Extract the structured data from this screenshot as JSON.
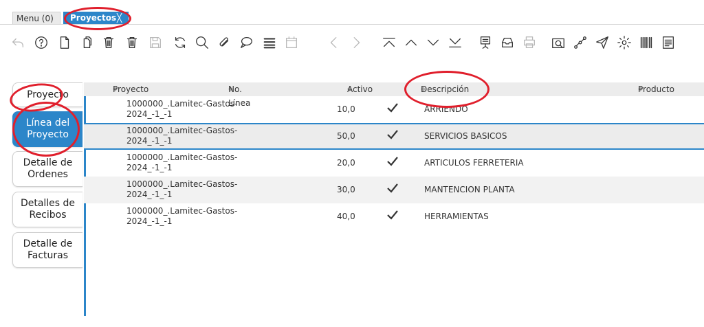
{
  "tabs": {
    "menu_label": "Menu (0)",
    "active_label": "Proyectos",
    "close_glyph": "╳"
  },
  "toolbar": {
    "icons": [
      "undo-icon",
      "help-icon",
      "new-record-icon",
      "copy-icon",
      "delete-icon",
      "delete-selection-icon",
      "save-icon",
      "refresh-icon",
      "find-icon",
      "attachment-icon",
      "chat-icon",
      "grid-toggle-icon",
      "calendar-icon",
      "previous-icon",
      "next-icon",
      "first-record-icon",
      "parent-icon",
      "detail-icon",
      "last-record-icon",
      "report-icon",
      "archive-icon",
      "print-icon",
      "zoom-across-icon",
      "workflow-icon",
      "send-icon",
      "settings-icon",
      "barcode-icon",
      "summary-icon"
    ]
  },
  "sidebar": {
    "items": [
      {
        "label": "Proyecto",
        "active": false
      },
      {
        "label": "Línea del Proyecto",
        "active": true
      },
      {
        "label": "Detalle de Ordenes",
        "active": false
      },
      {
        "label": "Detalles de Recibos",
        "active": false
      },
      {
        "label": "Detalle de Facturas",
        "active": false
      }
    ]
  },
  "grid": {
    "columns": [
      "Proyecto",
      "No. Línea",
      "Activo",
      "Descripción",
      "Producto"
    ],
    "rows": [
      {
        "proyecto": "1000000_.Lamitec-Gastos-2024_-1_-1",
        "linea": "10,0",
        "activo": true,
        "descripcion": "ARRIENDO"
      },
      {
        "proyecto": "1000000_.Lamitec-Gastos-2024_-1_-1",
        "linea": "50,0",
        "activo": true,
        "descripcion": "SERVICIOS BASICOS"
      },
      {
        "proyecto": "1000000_.Lamitec-Gastos-2024_-1_-1",
        "linea": "20,0",
        "activo": true,
        "descripcion": "ARTICULOS FERRETERIA"
      },
      {
        "proyecto": "1000000_.Lamitec-Gastos-2024_-1_-1",
        "linea": "30,0",
        "activo": true,
        "descripcion": "MANTENCION PLANTA"
      },
      {
        "proyecto": "1000000_.Lamitec-Gastos-2024_-1_-1",
        "linea": "40,0",
        "activo": true,
        "descripcion": "HERRAMIENTAS"
      }
    ]
  },
  "colors": {
    "accent": "#2c86c9",
    "annotation": "#e01f2c"
  }
}
